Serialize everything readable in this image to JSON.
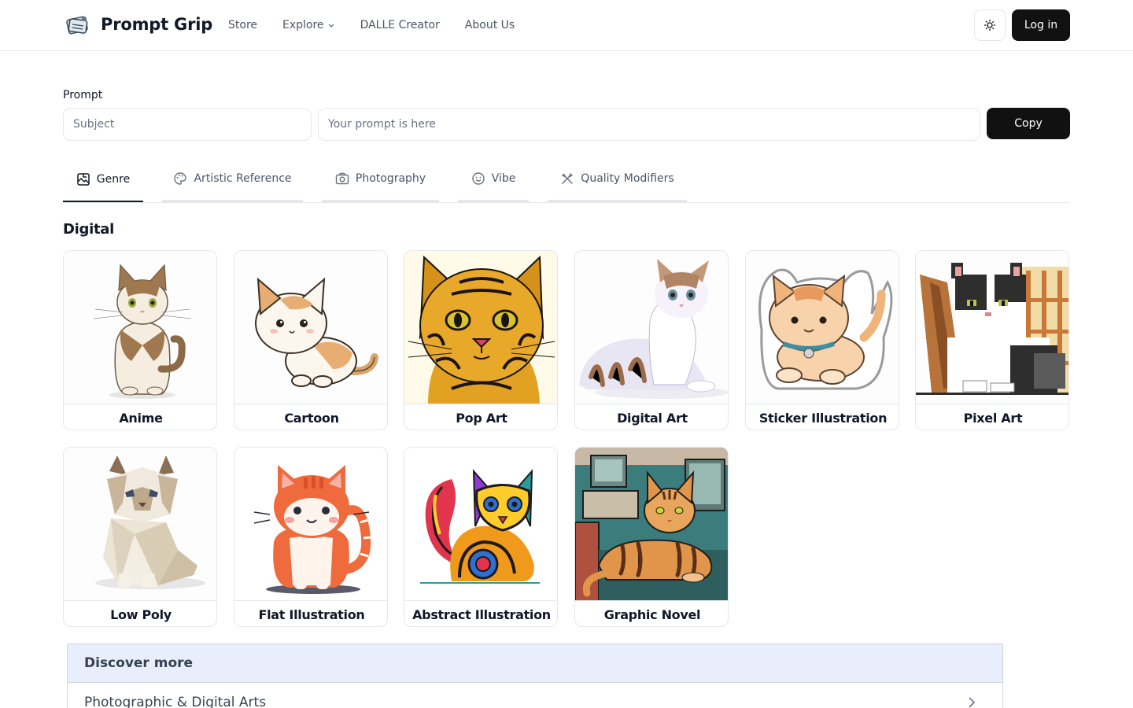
{
  "header": {
    "brand": "Prompt Grip",
    "nav": [
      "Store",
      "Explore",
      "DALLE Creator",
      "About Us"
    ],
    "login_label": "Log in"
  },
  "prompt": {
    "label": "Prompt",
    "subject_placeholder": "Subject",
    "prompt_placeholder": "Your prompt is here",
    "copy_label": "Copy"
  },
  "tabs": [
    {
      "label": "Genre",
      "icon": "genre-icon",
      "active": true
    },
    {
      "label": "Artistic Reference",
      "icon": "palette-icon",
      "active": false
    },
    {
      "label": "Photography",
      "icon": "camera-icon",
      "active": false
    },
    {
      "label": "Vibe",
      "icon": "smile-icon",
      "active": false
    },
    {
      "label": "Quality Modifiers",
      "icon": "tools-icon",
      "active": false
    }
  ],
  "section": {
    "title": "Digital",
    "cards": [
      {
        "label": "Anime"
      },
      {
        "label": "Cartoon"
      },
      {
        "label": "Pop Art"
      },
      {
        "label": "Digital Art"
      },
      {
        "label": "Sticker Illustration"
      },
      {
        "label": "Pixel Art"
      },
      {
        "label": "Low Poly"
      },
      {
        "label": "Flat Illustration"
      },
      {
        "label": "Abstract Illustration"
      },
      {
        "label": "Graphic Novel"
      }
    ]
  },
  "discover": {
    "title": "Discover more",
    "items": [
      "Photographic & Digital Arts"
    ]
  },
  "colors": {
    "primary_button": "#111111",
    "discover_header_bg": "#e8eefb",
    "border": "#e5e7eb"
  }
}
